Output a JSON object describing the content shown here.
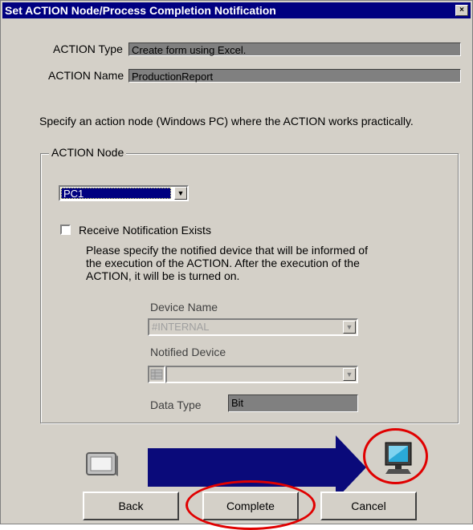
{
  "window": {
    "title": "Set ACTION Node/Process Completion Notification",
    "close_glyph": "×"
  },
  "action_type": {
    "label": "ACTION Type",
    "value": "Create form using Excel."
  },
  "action_name": {
    "label": "ACTION Name",
    "value": "ProductionReport"
  },
  "instruction": "Specify an action node (Windows PC) where the ACTION works practically.",
  "action_node": {
    "group_label": "ACTION Node",
    "selected": "PC1",
    "receive_checkbox": {
      "label": "Receive Notification Exists",
      "checked": false
    },
    "description": [
      "Please specify the notified device that will be informed of",
      "the execution of the ACTION. After the execution of the",
      "ACTION, it will be is turned on."
    ],
    "device_name": {
      "label": "Device Name",
      "value": "#INTERNAL"
    },
    "notified_device": {
      "label": "Notified Device",
      "value": ""
    },
    "data_type": {
      "label": "Data Type",
      "value": "Bit"
    }
  },
  "buttons": {
    "back": "Back",
    "complete": "Complete",
    "cancel": "Cancel"
  },
  "icons": [
    "display-panel-icon",
    "pc-monitor-icon",
    "device-list-icon"
  ],
  "colors": {
    "titlebar": "#000080",
    "arrow": "#0a0a7a",
    "highlight": "#e00000"
  }
}
